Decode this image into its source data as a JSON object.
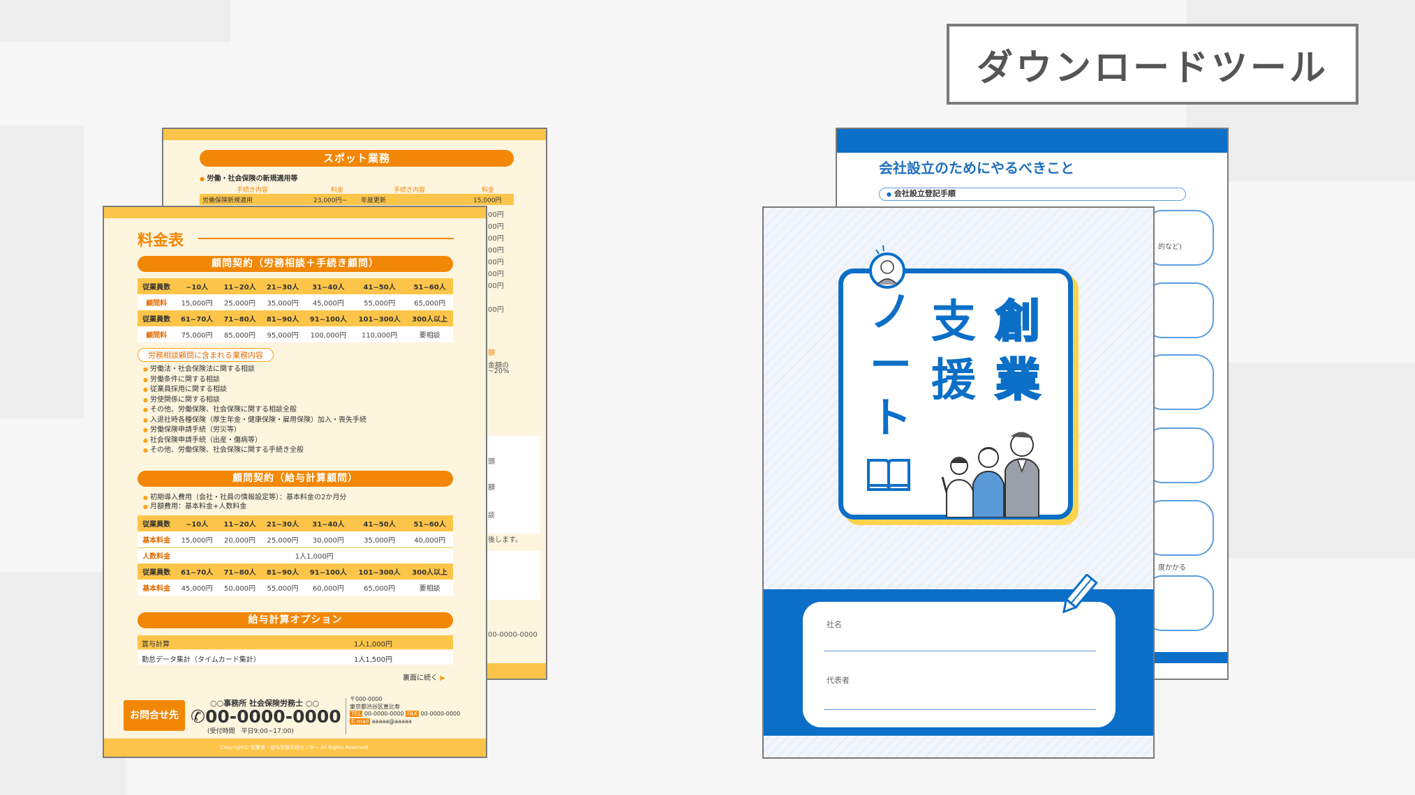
{
  "header_badge": "ダウンロードツール",
  "price_back": {
    "spot_title": "スポット業務",
    "section_title": "労働・社会保険の新規適用等",
    "col_proc": "手続き内容",
    "col_fee": "料金",
    "rows": [
      {
        "name": "労働保険新規適用",
        "fee": "23,000円~"
      },
      {
        "name": "年度更新",
        "fee": "15,000円"
      }
    ],
    "fragments": [
      "00円",
      "00円",
      "00円",
      "00円",
      "00円",
      "00円",
      "00円",
      "00円",
      "額",
      "金額の",
      "~20%",
      "頭",
      "額",
      "談",
      "後します。",
      "00-0000-0000"
    ]
  },
  "price_front": {
    "title": "料金表",
    "pill1": "顧問契約（労務相談＋手続き顧問）",
    "table1": {
      "head1": [
        "従業員数",
        "~10人",
        "11~20人",
        "21~30人",
        "31~40人",
        "41~50人",
        "51~60人"
      ],
      "row1": [
        "顧問料",
        "15,000円",
        "25,000円",
        "35,000円",
        "45,000円",
        "55,000円",
        "65,000円"
      ],
      "head2": [
        "従業員数",
        "61~70人",
        "71~80人",
        "81~90人",
        "91~100人",
        "101~300人",
        "300人以上"
      ],
      "row2": [
        "顧問料",
        "75,000円",
        "85,000円",
        "95,000円",
        "100,000円",
        "110,000円",
        "要相談"
      ]
    },
    "included_title": "労務相談顧問に含まれる業務内容",
    "included_items": [
      "労働法・社会保険法に関する相談",
      "労働条件に関する相談",
      "従業員採用に関する相談",
      "労使関係に関する相談",
      "その他、労働保険、社会保険に関する相談全般",
      "入退社時各種保険（厚生年金・健康保険・雇用保険）加入・喪失手続",
      "労働保険申請手続（労災等）",
      "社会保険申請手続（出産・傷病等）",
      "その他、労働保険、社会保険に関する手続き全般"
    ],
    "pill2": "顧問契約（給与計算顧問）",
    "payroll_notes": [
      "初期導入費用（会社・社員の情報設定等）：基本料金の2か月分",
      "月額費用：基本料金+人数料金"
    ],
    "table2": {
      "head1": [
        "従業員数",
        "~10人",
        "11~20人",
        "21~30人",
        "31~40人",
        "41~50人",
        "51~60人"
      ],
      "row1": [
        "基本料金",
        "15,000円",
        "20,000円",
        "25,000円",
        "30,000円",
        "35,000円",
        "40,000円"
      ],
      "row_person_label": "人数料金",
      "row_person_value": "1人1,000円",
      "head2": [
        "従業員数",
        "61~70人",
        "71~80人",
        "81~90人",
        "91~100人",
        "101~300人",
        "300人以上"
      ],
      "row2": [
        "基本料金",
        "45,000円",
        "50,000円",
        "55,000円",
        "60,000円",
        "65,000円",
        "要相談"
      ]
    },
    "pill3": "給与計算オプション",
    "options": [
      {
        "name": "賞与計算",
        "fee": "1人1,000円"
      },
      {
        "name": "勤怠データ集計（タイムカード集計）",
        "fee": "1人1,500円"
      }
    ],
    "continue": "裏面に続く",
    "contact_btn": "お問合せ先",
    "office": "○○事務所 社会保険労務士 ○○",
    "phone": "00-0000-0000",
    "hours": "(受付時間　平日9:00~17:00)",
    "postal": "〒000-0000",
    "address": "東京都渋谷区恵比寿",
    "tel_label": "TEL",
    "tel": "00-0000-0000",
    "fax_label": "FAX",
    "fax": "00-0000-0000",
    "mail_label": "E-mail",
    "mail": "aaaaa@aaaaa",
    "copyright": "Copyright© 起業者・給与労務手続センター All Rights Reserved."
  },
  "note_back": {
    "title": "会社設立のためにやるべきこと",
    "subtitle": "会社設立登記手順",
    "fragments": [
      "的など)",
      "度かかる"
    ]
  },
  "note_front": {
    "title_chars": [
      "創",
      "業",
      "支",
      "援",
      "ノ",
      "ー",
      "ト"
    ],
    "company_label": "社名",
    "rep_label": "代表者"
  },
  "colors": {
    "orange": "#f28705",
    "yellow": "#fcc54a",
    "cream": "#fef5de",
    "blue": "#0b6fc7",
    "navy_text": "#1f6fbd"
  }
}
